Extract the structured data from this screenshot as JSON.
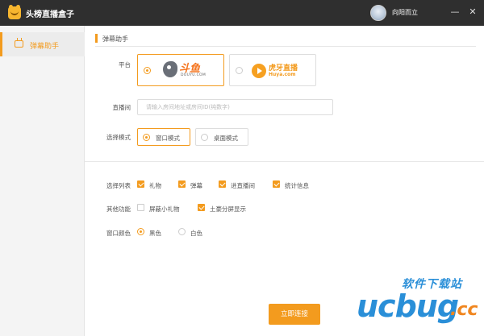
{
  "app": {
    "title": "头榜直播盒子",
    "user_name": "向阳而立",
    "min_glyph": "—",
    "close_glyph": "✕"
  },
  "sidebar": {
    "items": [
      {
        "label": "弹幕助手",
        "icon": "barrage-tv-icon",
        "active": true
      }
    ]
  },
  "main": {
    "section_title": "弹幕助手",
    "platform": {
      "label": "平台",
      "options": [
        {
          "name": "douyu",
          "logo_text": "斗鱼",
          "logo_sub": "DOUYU.COM",
          "selected": true
        },
        {
          "name": "huya",
          "logo_text": "虎牙直播",
          "logo_sub": "Huya.com",
          "selected": false
        }
      ]
    },
    "room": {
      "label": "直播间",
      "placeholder": "请输入房间地址或房间ID(纯数字)",
      "value": ""
    },
    "mode": {
      "label": "选择模式",
      "options": [
        {
          "label": "窗口模式",
          "selected": true
        },
        {
          "label": "桌面模式",
          "selected": false
        }
      ]
    },
    "list": {
      "label": "选择列表",
      "options": [
        {
          "label": "礼物",
          "checked": true
        },
        {
          "label": "弹幕",
          "checked": true
        },
        {
          "label": "进直播间",
          "checked": true
        },
        {
          "label": "统计信息",
          "checked": true
        }
      ]
    },
    "other": {
      "label": "其他功能",
      "options": [
        {
          "label": "屏蔽小礼物",
          "checked": false
        },
        {
          "label": "土豪分屏显示",
          "checked": true
        }
      ]
    },
    "color": {
      "label": "窗口颜色",
      "options": [
        {
          "label": "黑色",
          "selected": true
        },
        {
          "label": "白色",
          "selected": false
        }
      ]
    },
    "connect_label": "立即连接"
  },
  "watermark": {
    "top": "软件下载站",
    "main": "ucbug",
    "suffix": ".cc"
  },
  "colors": {
    "accent": "#f39b1e",
    "titlebar": "#2f2f2f",
    "sidebar": "#f4f4f4",
    "watermark_blue": "#2a8fd8"
  }
}
